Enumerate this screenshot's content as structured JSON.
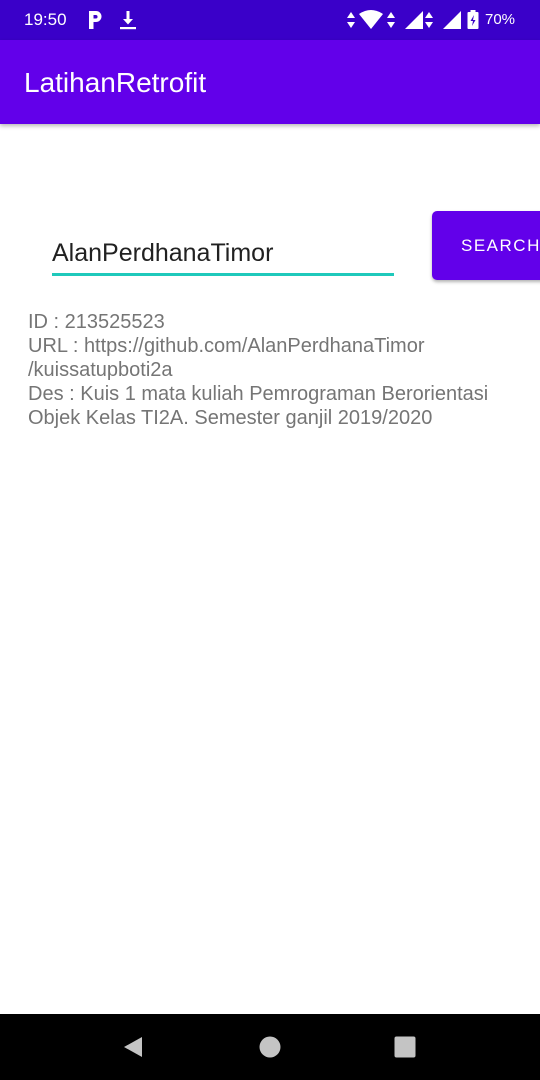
{
  "status_bar": {
    "time": "19:50",
    "battery": "70%",
    "icons": [
      "parking-icon",
      "download-icon",
      "data-arrows-icon",
      "wifi-icon",
      "signal-icon",
      "signal-icon",
      "battery-charging-icon"
    ]
  },
  "app_bar": {
    "title": "LatihanRetrofit"
  },
  "search": {
    "value": "AlanPerdhanaTimor",
    "button_label": "SEARCH"
  },
  "result": {
    "lines": [
      "ID : 213525523",
      "URL : https://github.com/AlanPerdhanaTimor",
      "/kuissatupboti2a",
      "Des : Kuis 1 mata kuliah Pemrograman Berorientasi",
      "Objek Kelas TI2A. Semester ganjil 2019/2020"
    ]
  },
  "nav_bar": {
    "icons": [
      "back-icon",
      "home-icon",
      "recents-icon"
    ]
  },
  "colors": {
    "status_bar": "#3a00c9",
    "primary": "#6200ea",
    "accent": "#1fc9bb",
    "result_text": "#757575"
  }
}
